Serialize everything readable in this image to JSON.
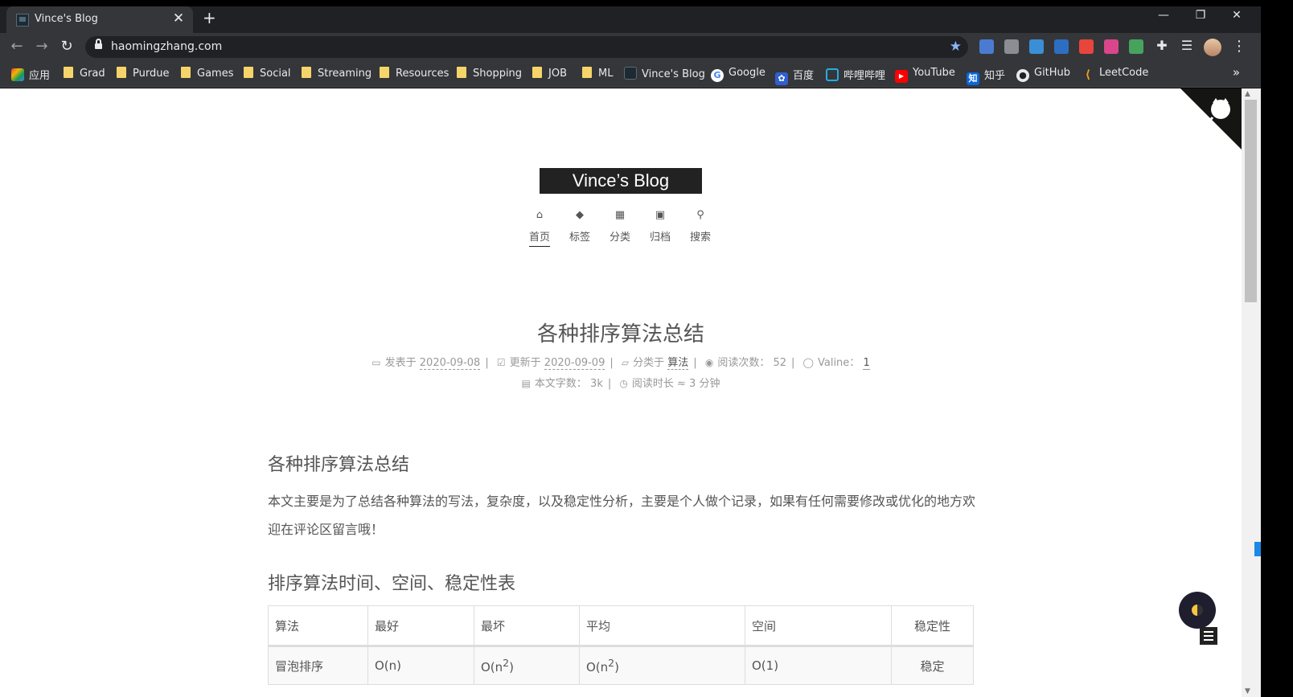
{
  "browser": {
    "tab_title": "Vince's Blog",
    "url": "haomingzhang.com",
    "new_tab": "+",
    "close": "✕",
    "win_min": "—",
    "win_max": "❐",
    "win_close": "✕"
  },
  "bookmarks": [
    {
      "label": "应用",
      "kind": "apps"
    },
    {
      "label": "Grad",
      "kind": "folder"
    },
    {
      "label": "Purdue",
      "kind": "folder"
    },
    {
      "label": "Games",
      "kind": "folder"
    },
    {
      "label": "Social",
      "kind": "folder"
    },
    {
      "label": "Streaming",
      "kind": "folder"
    },
    {
      "label": "Resources",
      "kind": "folder"
    },
    {
      "label": "Shopping",
      "kind": "folder"
    },
    {
      "label": "JOB",
      "kind": "folder"
    },
    {
      "label": "ML",
      "kind": "folder"
    },
    {
      "label": "Vince's Blog",
      "kind": "site"
    },
    {
      "label": "Google",
      "kind": "google"
    },
    {
      "label": "百度",
      "kind": "baidu"
    },
    {
      "label": "哔哩哔哩",
      "kind": "bilibili"
    },
    {
      "label": "YouTube",
      "kind": "youtube"
    },
    {
      "label": "知乎",
      "kind": "zhihu"
    },
    {
      "label": "GitHub",
      "kind": "github"
    },
    {
      "label": "LeetCode",
      "kind": "leetcode"
    }
  ],
  "site": {
    "brand": "Vince’s Blog",
    "menu": [
      {
        "label": "首页",
        "icon": "home-icon",
        "glyph": "⌂",
        "active": true
      },
      {
        "label": "标签",
        "icon": "tags-icon",
        "glyph": "◆"
      },
      {
        "label": "分类",
        "icon": "th-icon",
        "glyph": "▦"
      },
      {
        "label": "归档",
        "icon": "archive-icon",
        "glyph": "▣"
      },
      {
        "label": "搜索",
        "icon": "search-icon",
        "glyph": "⚲"
      }
    ]
  },
  "post": {
    "title": "各种排序算法总结",
    "meta": {
      "posted_label": "发表于",
      "posted_date": "2020-09-08",
      "updated_label": "更新于",
      "updated_date": "2020-09-09",
      "category_label": "分类于",
      "category": "算法",
      "views_label": "阅读次数：",
      "views": "52",
      "valine_label": "Valine：",
      "valine_count": "1",
      "words_label": "本文字数：",
      "words": "3k",
      "time_label": "阅读时长 ≈",
      "time": "3 分钟"
    },
    "h1": "各种排序算法总结",
    "intro": "本文主要是为了总结各种算法的写法，复杂度，以及稳定性分析，主要是个人做个记录，如果有任何需要修改或优化的地方欢迎在评论区留言哦！",
    "h2": "排序算法时间、空间、稳定性表",
    "table": {
      "headers": [
        "算法",
        "最好",
        "最坏",
        "平均",
        "空间",
        "稳定性"
      ],
      "rows": [
        {
          "name": "冒泡排序",
          "best": "O(n)",
          "worst_base": "O(n",
          "worst_exp": "2",
          "worst_close": ")",
          "avg_base": "O(n",
          "avg_exp": "2",
          "avg_close": ")",
          "space": "O(1)",
          "stable": "稳定"
        }
      ]
    }
  },
  "colors": {
    "accent": "#222222",
    "text": "#555555",
    "meta": "#999999",
    "browser_bg": "#202124",
    "toolbar_bg": "#35363a"
  }
}
